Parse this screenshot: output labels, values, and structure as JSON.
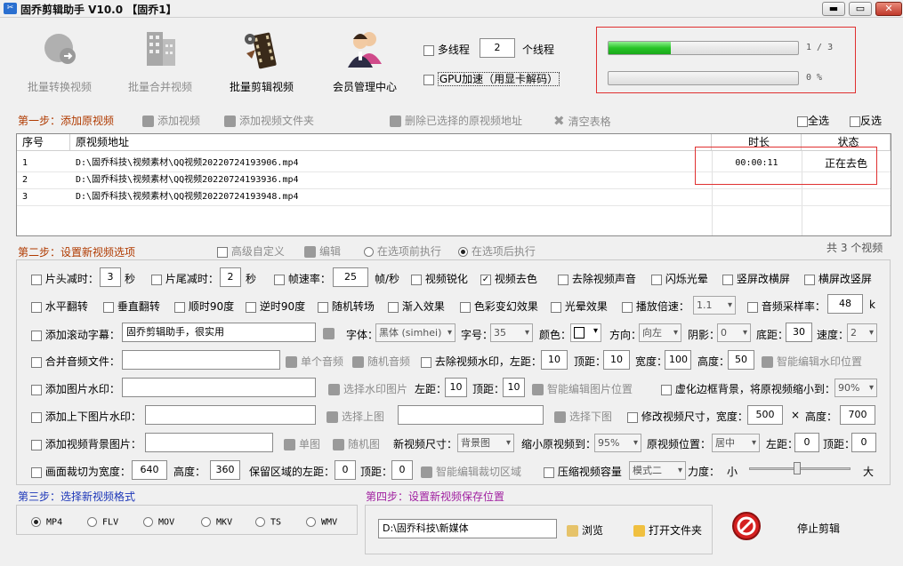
{
  "window": {
    "title": "固乔剪辑助手 V10.0  【固乔1】",
    "min": "▬",
    "max": "▭",
    "close": "✕"
  },
  "toolbar": [
    {
      "label": "批量转换视频",
      "icon": "convert-video-icon",
      "enabled": false
    },
    {
      "label": "批量合并视频",
      "icon": "merge-video-icon",
      "enabled": false
    },
    {
      "label": "批量剪辑视频",
      "icon": "film-reel-icon",
      "enabled": true
    },
    {
      "label": "会员管理中心",
      "icon": "users-icon",
      "enabled": true
    }
  ],
  "threads": {
    "multi_label": "多线程",
    "count": "2",
    "unit": "个线程",
    "gpu_label": "GPU加速（用显卡解码）"
  },
  "progress": {
    "bar1_text": "1 / 3",
    "bar1_value": 0.33,
    "bar2_text": "0 %",
    "bar2_value": 0
  },
  "step1": {
    "title": "第一步：添加原视频",
    "add_video": "添加视频",
    "add_folder": "添加视频文件夹",
    "delete_selected": "删除已选择的原视频地址",
    "clear_table": "清空表格",
    "select_all": "全选",
    "invert": "反选"
  },
  "table": {
    "headers": [
      "序号",
      "原视频地址",
      "时长",
      "状态"
    ],
    "rows": [
      {
        "no": "1",
        "path": "D:\\固乔科技\\视频素材\\QQ视频20220724193906.mp4",
        "duration": "00:00:11",
        "status": "正在去色"
      },
      {
        "no": "2",
        "path": "D:\\固乔科技\\视频素材\\QQ视频20220724193936.mp4",
        "duration": "",
        "status": ""
      },
      {
        "no": "3",
        "path": "D:\\固乔科技\\视频素材\\QQ视频20220724193948.mp4",
        "duration": "",
        "status": ""
      }
    ]
  },
  "step2": {
    "title": "第二步：设置新视频选项",
    "advanced": "高级自定义",
    "edit": "编辑",
    "before": "在选项前执行",
    "after": "在选项后执行",
    "count": "共 3 个视频"
  },
  "opts": {
    "head_cut": "片头减时：",
    "head_val": "3",
    "sec": "秒",
    "tail_cut": "片尾减时：",
    "tail_val": "2",
    "sec2": "秒",
    "fps": "帧速率：",
    "fps_val": "25",
    "fps_unit": "帧/秒",
    "sharpen": "视频锐化",
    "decolor": "视频去色",
    "remove_audio": "去除视频声音",
    "flash": "闪烁光晕",
    "v2h": "竖屏改横屏",
    "h2v": "横屏改竖屏",
    "hflip": "水平翻转",
    "vflip": "垂直翻转",
    "cw90": "顺时90度",
    "ccw90": "逆时90度",
    "random_trans": "随机转场",
    "fade_in": "渐入效果",
    "color_change": "色彩变幻效果",
    "halo": "光晕效果",
    "speed": "播放倍速：",
    "speed_val": "1.1",
    "samplerate": "音频采样率：",
    "samplerate_val": "48",
    "k": "k",
    "subtitle": "添加滚动字幕：",
    "subtitle_val": "固乔剪辑助手，很实用",
    "font": "字体：",
    "font_val": "黑体 (simhei)",
    "size": "字号：",
    "size_val": "35",
    "color": "颜色：",
    "dir": "方向：",
    "dir_val": "向左",
    "shadow": "阴影：",
    "shadow_val": "0",
    "bottom": "底距：",
    "bottom_val": "30",
    "velocity": "速度：",
    "velocity_val": "2",
    "merge_audio": "合并音频文件：",
    "single_audio": "单个音频",
    "random_audio": "随机音频",
    "remove_wm": "去除视频水印，左距：",
    "wm_left": "10",
    "top": "顶距：",
    "wm_top": "10",
    "width": "宽度：",
    "wm_width": "100",
    "height": "高度：",
    "wm_height": "50",
    "smart_wm": "智能编辑水印位置",
    "img_wm": "添加图片水印：",
    "choose_wm": "选择水印图片",
    "left": "左距：",
    "iw_left": "10",
    "top2": "顶距：",
    "iw_top": "10",
    "smart_img": "智能编辑图片位置",
    "blur_bg": "虚化边框背景，将原视频缩小到：",
    "blur_val": "90%",
    "updown_wm": "添加上下图片水印：",
    "choose_top": "选择上图",
    "choose_bottom": "选择下图",
    "resize": "修改视频尺寸，宽度：",
    "rw": "500",
    "x": "×",
    "rh_label": "高度：",
    "rh": "700",
    "bg_img": "添加视频背景图片：",
    "single_img": "单图",
    "random_img": "随机图",
    "new_size": "新视频尺寸：",
    "new_size_val": "背景图",
    "shrink": "缩小原视频到：",
    "shrink_val": "95%",
    "pos": "原视频位置：",
    "pos_val": "居中",
    "left2": "左距：",
    "bl": "0",
    "top3": "顶距：",
    "bt": "0",
    "crop": "画面裁切为宽度：",
    "crop_w": "640",
    "crop_h_label": "高度：",
    "crop_h": "360",
    "keep": "保留区域的左距：",
    "keep_l": "0",
    "top4": "顶距：",
    "keep_t": "0",
    "smart_crop": "智能编辑裁切区域",
    "compress": "压缩视频容量",
    "mode": "模式二",
    "strength": "力度：",
    "small": "小",
    "big": "大",
    "strength_value": 0.45
  },
  "step3": {
    "title": "第三步：选择新视频格式",
    "formats": [
      "MP4",
      "FLV",
      "MOV",
      "MKV",
      "TS",
      "WMV"
    ],
    "selected": "MP4"
  },
  "step4": {
    "title": "第四步：设置新视频保存位置",
    "path": "D:\\固乔科技\\新媒体",
    "browse": "浏览",
    "open_folder": "打开文件夹"
  },
  "stop": {
    "label": "停止剪辑"
  },
  "colors": {
    "highlight": "#e03030",
    "progress": "#27c427",
    "step_red": "#b03a00",
    "step_purple": "#a020a0",
    "step_blue": "#1c36b8"
  }
}
